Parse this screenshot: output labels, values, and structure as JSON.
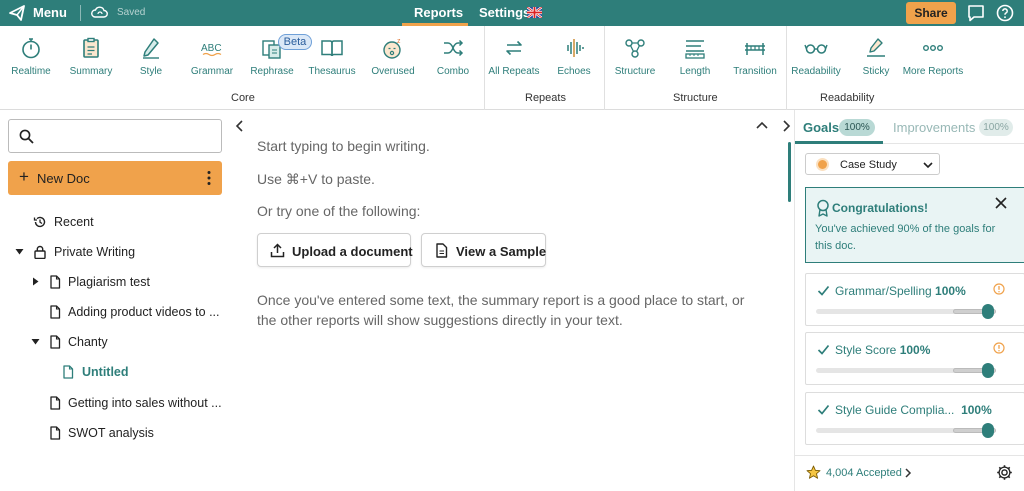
{
  "topbar": {
    "menu_label": "Menu",
    "saved_label": "Saved",
    "tabs": [
      {
        "label": "Reports",
        "active": true
      },
      {
        "label": "Settings",
        "active": false
      }
    ],
    "settings_flag": "uk-flag-icon",
    "share_label": "Share"
  },
  "toolbar": {
    "groups": {
      "core": {
        "label": "Core",
        "tools": [
          {
            "label": "Realtime",
            "icon": "stopwatch-icon"
          },
          {
            "label": "Summary",
            "icon": "clipboard-icon"
          },
          {
            "label": "Style",
            "icon": "pen-icon"
          },
          {
            "label": "Grammar",
            "icon": "abc-icon"
          },
          {
            "label": "Rephrase",
            "icon": "rephrase-icon",
            "badge": "Beta"
          },
          {
            "label": "Thesaurus",
            "icon": "book-icon"
          },
          {
            "label": "Overused",
            "icon": "sleepy-face-icon"
          },
          {
            "label": "Combo",
            "icon": "shuffle-icon"
          }
        ]
      },
      "repeats": {
        "label": "Repeats",
        "tools": [
          {
            "label": "All Repeats",
            "icon": "repeat-arrows-icon"
          },
          {
            "label": "Echoes",
            "icon": "soundwave-icon"
          }
        ]
      },
      "structure": {
        "label": "Structure",
        "tools": [
          {
            "label": "Structure",
            "icon": "nodes-icon"
          },
          {
            "label": "Length",
            "icon": "ruler-icon"
          },
          {
            "label": "Transition",
            "icon": "bridge-icon"
          }
        ]
      },
      "readability": {
        "label": "Readability",
        "tools": [
          {
            "label": "Readability",
            "icon": "glasses-icon"
          },
          {
            "label": "Sticky",
            "icon": "sticky-pen-icon"
          },
          {
            "label": "More Reports",
            "icon": "more-dots-icon"
          }
        ]
      }
    }
  },
  "sidebar": {
    "search_placeholder": "",
    "new_doc_label": "New Doc",
    "tree": [
      {
        "label": "Recent",
        "icon": "history-icon"
      },
      {
        "label": "Private Writing",
        "icon": "lock-icon"
      },
      {
        "label": "Plagiarism test",
        "icon": "document-icon"
      },
      {
        "label": "Adding product videos to ...",
        "icon": "document-icon"
      },
      {
        "label": "Chanty",
        "icon": "document-icon"
      },
      {
        "label": "Untitled",
        "icon": "document-icon",
        "active": true
      },
      {
        "label": "Getting into sales without ...",
        "icon": "document-icon"
      },
      {
        "label": "SWOT analysis",
        "icon": "document-icon"
      }
    ]
  },
  "editor": {
    "line1": "Start typing to begin writing.",
    "line2": "Use ⌘+V to paste.",
    "line3": "Or try one of the following:",
    "upload_label": "Upload a document",
    "sample_label": "View a Sample",
    "hint": "Once you've entered some text, the summary report is a good place to start, or the other reports will show suggestions directly in your text."
  },
  "rpanel": {
    "goals_tab": "Goals",
    "goals_badge": "100%",
    "improvements_tab": "Improvements",
    "improvements_badge": "100%",
    "goal_select": "Case Study",
    "congrats_title": "Congratulations!",
    "congrats_text": "You've achieved 90% of the goals for this doc.",
    "goals": [
      {
        "label": "Grammar/Spelling",
        "value": "100%",
        "level": 1.0
      },
      {
        "label": "Style Score",
        "value": "100%",
        "level": 1.0
      },
      {
        "label": "Style Guide Complia...",
        "value": "100%",
        "level": 1.0
      }
    ],
    "accepted_label": "4,004 Accepted"
  },
  "colors": {
    "brand_teal": "#2e7e7a",
    "accent_orange": "#f0a24b",
    "beta_blue": "#dbe8f7"
  }
}
